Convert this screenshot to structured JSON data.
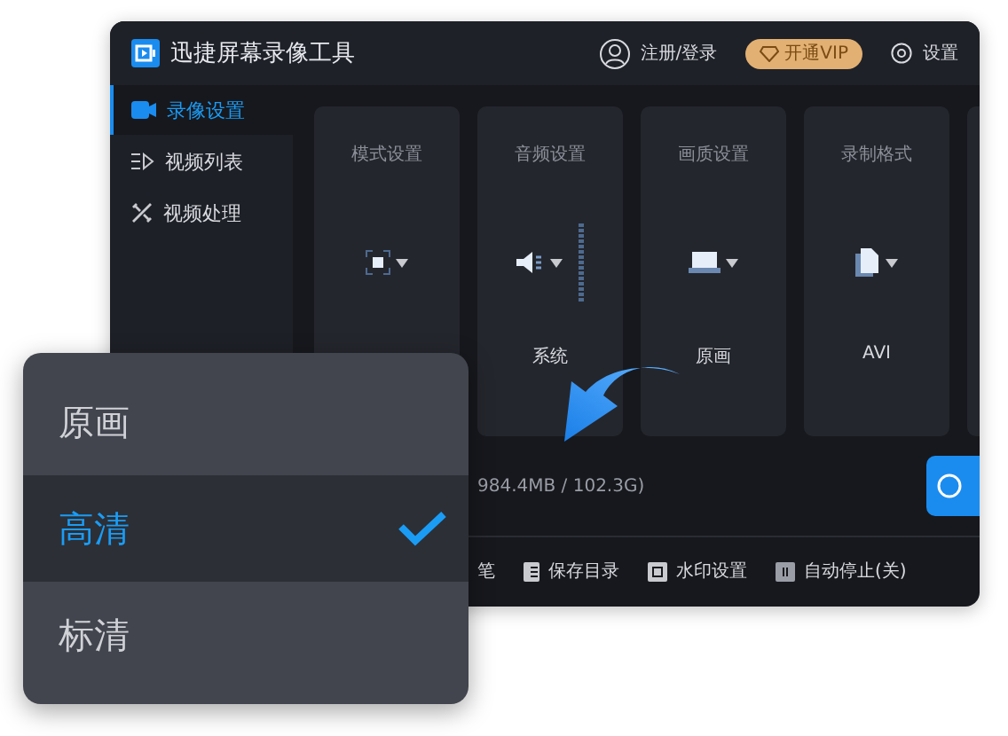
{
  "app": {
    "title": "迅捷屏幕录像工具",
    "account": "注册/登录",
    "vip": "开通VIP",
    "settings": "设置"
  },
  "sidebar": {
    "items": [
      {
        "label": "录像设置",
        "kind": "record",
        "selected": true
      },
      {
        "label": "视频列表",
        "kind": "list",
        "selected": false
      },
      {
        "label": "视频处理",
        "kind": "edit",
        "selected": false
      }
    ]
  },
  "cards": [
    {
      "title": "模式设置",
      "kind": "mode"
    },
    {
      "title": "音频设置",
      "kind": "audio",
      "value": "系统"
    },
    {
      "title": "画质设置",
      "kind": "quality",
      "value": "原画"
    },
    {
      "title": "录制格式",
      "kind": "format",
      "value": "AVI"
    },
    {
      "kind": "blank"
    }
  ],
  "storage": "984.4MB / 102.3G)",
  "toolbar": [
    {
      "label": "笔",
      "kind": "text"
    },
    {
      "label": "保存目录",
      "kind": "folder"
    },
    {
      "label": "水印设置",
      "kind": "watermark"
    },
    {
      "label": "自动停止(关)",
      "kind": "stop"
    }
  ],
  "dropdown": {
    "options": [
      {
        "label": "原画",
        "selected": false
      },
      {
        "label": "高清",
        "selected": true
      },
      {
        "label": "标清",
        "selected": false
      }
    ]
  }
}
